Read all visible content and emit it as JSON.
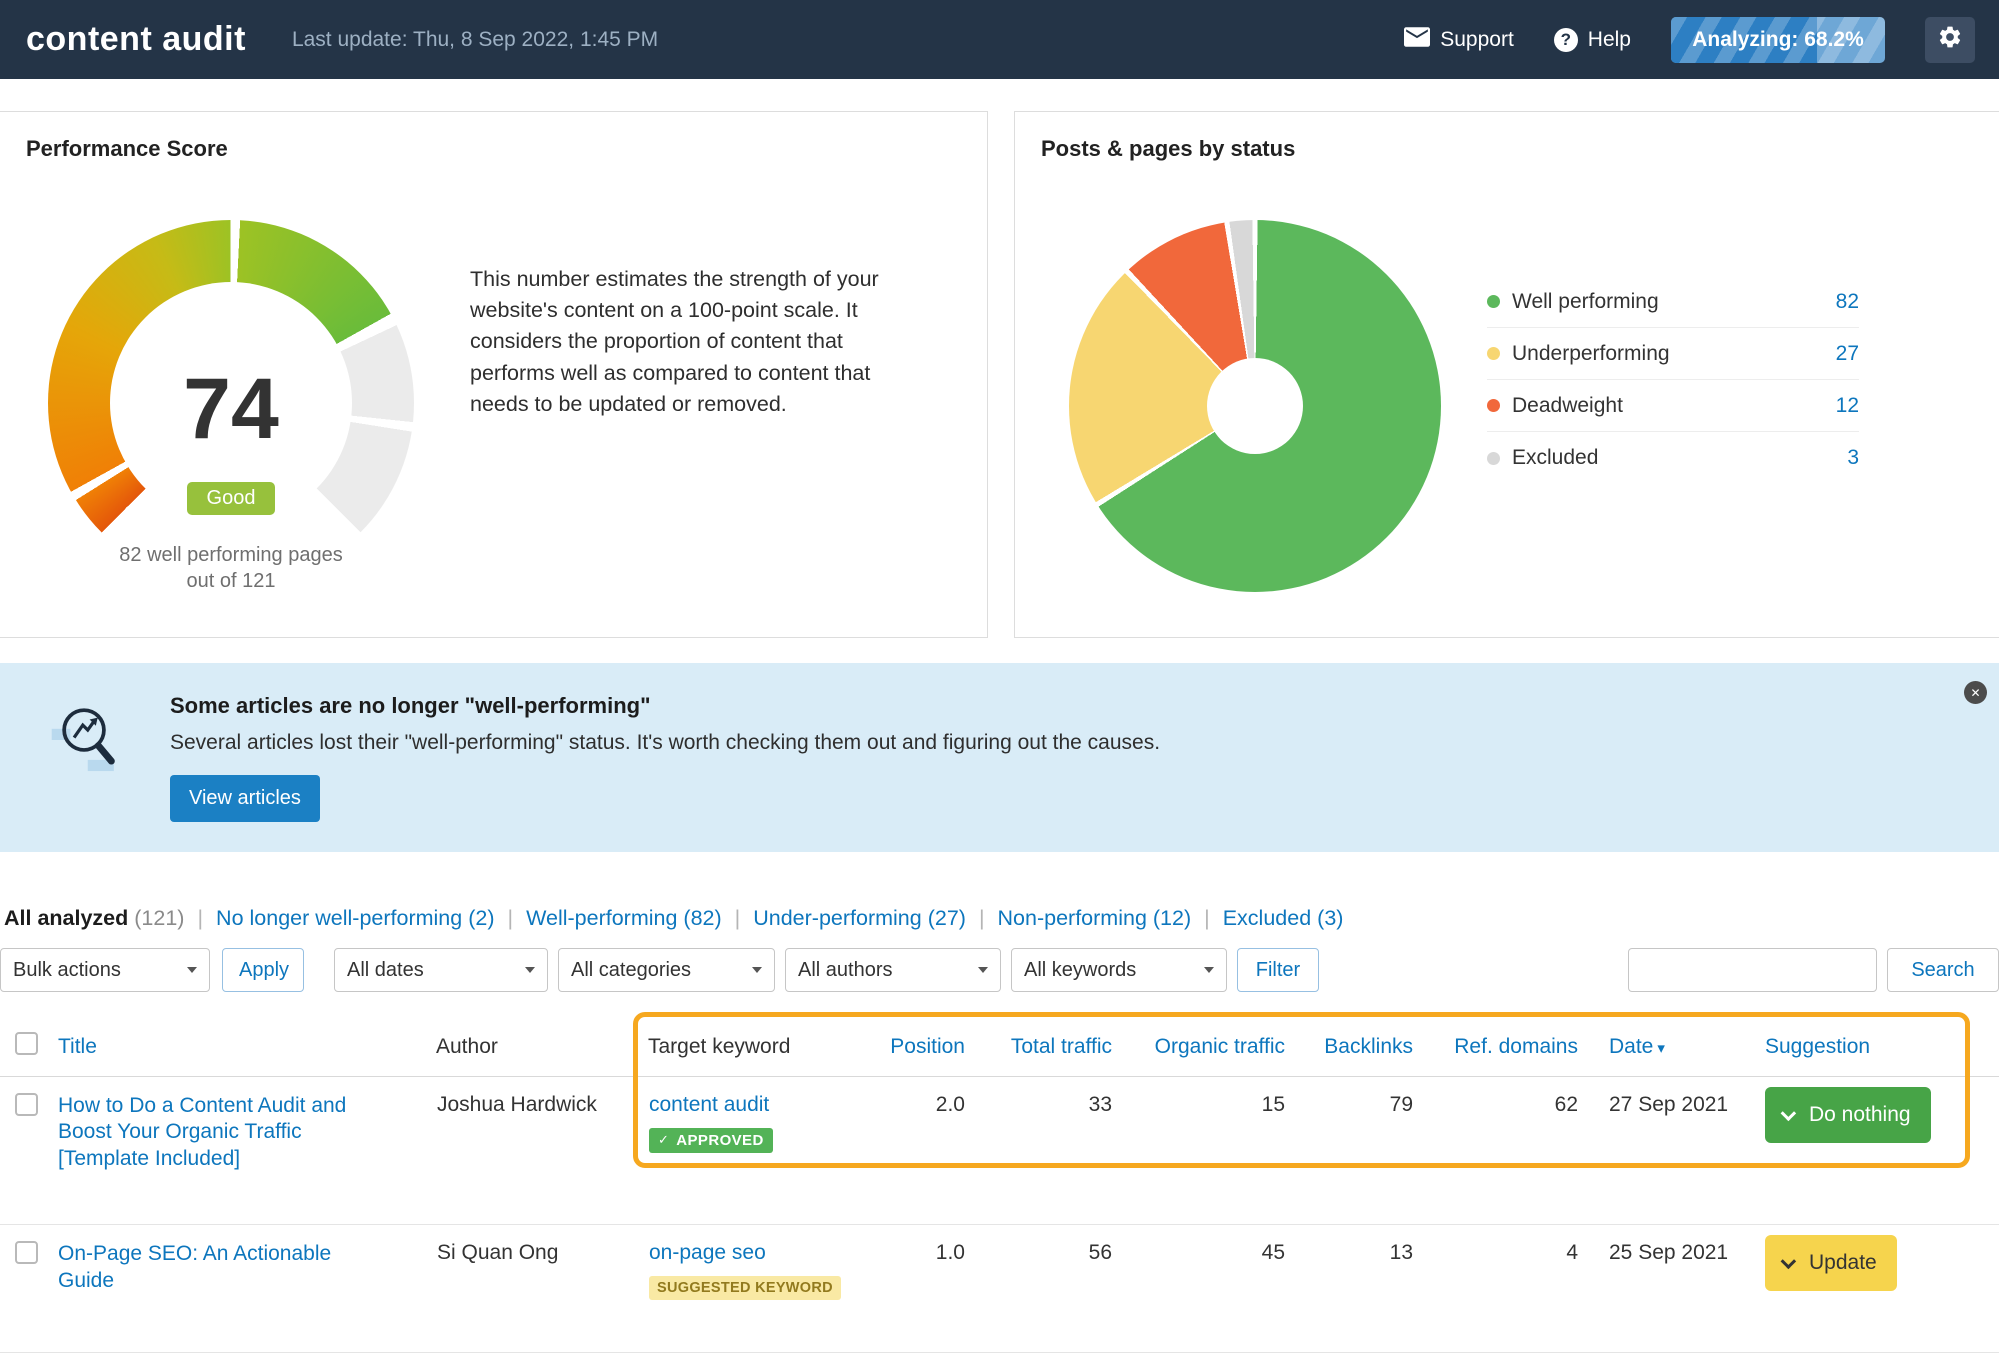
{
  "navbar": {
    "logo": "content audit",
    "last_update": "Last update: Thu, 8 Sep 2022, 1:45 PM",
    "support": "Support",
    "help": "Help",
    "analyzing": "Analyzing: 68.2%",
    "analyzing_percent": 68.2
  },
  "icons": {
    "sort_desc": "▾",
    "check": "✓",
    "close": "✕",
    "help_glyph": "?"
  },
  "performance_card": {
    "title": "Performance Score",
    "score": "74",
    "badge": "Good",
    "caption_line1": "82 well performing pages",
    "caption_line2": "out of 121",
    "description": "This number estimates the strength of your website's content on a 100-point scale. It considers the proportion of content that performs well as compared to content that needs to be updated or removed."
  },
  "status_card": {
    "title": "Posts & pages by status",
    "legend": [
      {
        "label": "Well performing",
        "value": "82",
        "color": "#5cb85c"
      },
      {
        "label": "Underperforming",
        "value": "27",
        "color": "#f7d671"
      },
      {
        "label": "Deadweight",
        "value": "12",
        "color": "#f1683b"
      },
      {
        "label": "Excluded",
        "value": "3",
        "color": "#d8d8d8"
      }
    ]
  },
  "chart_data": [
    {
      "type": "gauge",
      "title": "Performance Score",
      "value": 74,
      "min": 0,
      "max": 100,
      "badge": "Good",
      "annotation": "82 well performing pages out of 121",
      "color_scale": [
        "#e4570a",
        "#f08006",
        "#e5a609",
        "#c6bb16",
        "#9dc224",
        "#6abc3a"
      ],
      "track_color": "#ebebeb"
    },
    {
      "type": "pie",
      "donut": true,
      "title": "Posts & pages by status",
      "categories": [
        "Well performing",
        "Underperforming",
        "Deadweight",
        "Excluded"
      ],
      "values": [
        82,
        27,
        12,
        3
      ],
      "colors": [
        "#5cb85c",
        "#f7d671",
        "#f1683b",
        "#d8d8d8"
      ],
      "legend_position": "right"
    }
  ],
  "banner": {
    "title": "Some articles are no longer \"well-performing\"",
    "body": "Several articles lost their \"well-performing\" status. It's worth checking them out and figuring out the causes.",
    "button": "View articles"
  },
  "tabs": {
    "separator": "|",
    "active_label": "All analyzed",
    "active_count": "(121)",
    "items": [
      {
        "label": "No longer well-performing",
        "count": "(2)"
      },
      {
        "label": "Well-performing",
        "count": "(82)"
      },
      {
        "label": "Under-performing",
        "count": "(27)"
      },
      {
        "label": "Non-performing",
        "count": "(12)"
      },
      {
        "label": "Excluded",
        "count": "(3)"
      }
    ]
  },
  "controls": {
    "bulk_actions": "Bulk actions",
    "apply": "Apply",
    "dates": "All dates",
    "categories": "All categories",
    "authors": "All authors",
    "keywords": "All keywords",
    "filter": "Filter",
    "search": "Search",
    "search_value": ""
  },
  "table": {
    "columns": {
      "title": "Title",
      "author": "Author",
      "keyword": "Target keyword",
      "position": "Position",
      "total_traffic": "Total traffic",
      "organic_traffic": "Organic traffic",
      "backlinks": "Backlinks",
      "ref_domains": "Ref. domains",
      "date": "Date",
      "suggestion": "Suggestion"
    },
    "rows": [
      {
        "title": "How to Do a Content Audit and Boost Your Organic Traffic [Template Included]",
        "author": "Joshua Hardwick",
        "keyword": "content audit",
        "badge": "APPROVED",
        "position": "2.0",
        "total_traffic": "33",
        "organic_traffic": "15",
        "backlinks": "79",
        "ref_domains": "62",
        "date": "27 Sep 2021",
        "suggestion": "Do nothing"
      },
      {
        "title": "On-Page SEO: An Actionable Guide",
        "author": "Si Quan Ong",
        "keyword": "on-page seo",
        "badge": "SUGGESTED KEYWORD",
        "position": "1.0",
        "total_traffic": "56",
        "organic_traffic": "45",
        "backlinks": "13",
        "ref_domains": "4",
        "date": "25 Sep 2021",
        "suggestion": "Update"
      }
    ]
  }
}
